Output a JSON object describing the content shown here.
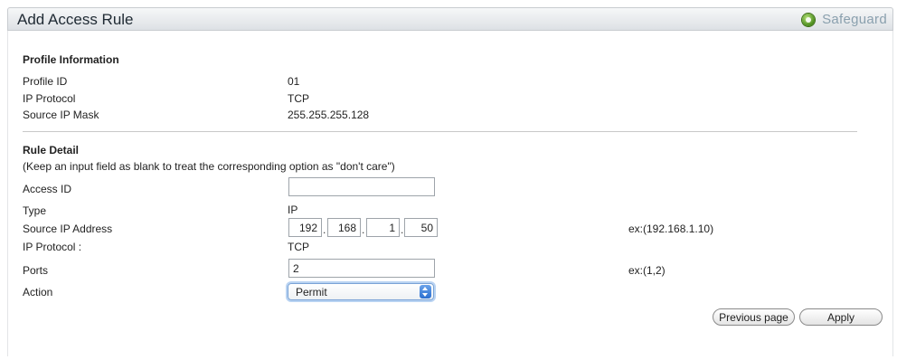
{
  "header": {
    "title": "Add Access Rule",
    "badge": "Safeguard"
  },
  "profile": {
    "heading": "Profile Information",
    "rows": [
      {
        "label": "Profile ID",
        "value": "01"
      },
      {
        "label": "IP Protocol",
        "value": "TCP"
      },
      {
        "label": "Source IP Mask",
        "value": "255.255.255.128"
      }
    ]
  },
  "rule": {
    "heading": "Rule Detail",
    "note": "(Keep an input field as blank to treat the corresponding option as \"don't care\")",
    "access_id": {
      "label": "Access ID",
      "value": ""
    },
    "type": {
      "label": "Type",
      "value": "IP"
    },
    "source_ip": {
      "label": "Source IP Address",
      "octets": [
        "192",
        "168",
        "1",
        "50"
      ],
      "example": "ex:(192.168.1.10)"
    },
    "ip_protocol": {
      "label": "IP Protocol :",
      "value": "TCP"
    },
    "ports": {
      "label": "Ports",
      "value": "2",
      "example": "ex:(1,2)"
    },
    "action": {
      "label": "Action",
      "selected": "Permit"
    }
  },
  "buttons": {
    "previous": "Previous page",
    "apply": "Apply"
  }
}
